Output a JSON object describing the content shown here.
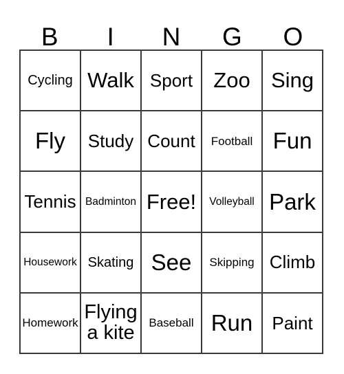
{
  "card": {
    "title": "BINGO",
    "header_letters": [
      "B",
      "I",
      "N",
      "G",
      "O"
    ],
    "free_space_label": "Free!",
    "colors": {
      "border": "#3a3a3a",
      "cell_background": "#ffffff",
      "text": "#000000"
    },
    "rows": [
      [
        {
          "label": "Cycling",
          "size": "sm"
        },
        {
          "label": "Walk",
          "size": "lg"
        },
        {
          "label": "Sport",
          "size": "md"
        },
        {
          "label": "Zoo",
          "size": "lg"
        },
        {
          "label": "Sing",
          "size": "lg"
        }
      ],
      [
        {
          "label": "Fly",
          "size": "xl"
        },
        {
          "label": "Study",
          "size": "md"
        },
        {
          "label": "Count",
          "size": "md"
        },
        {
          "label": "Football",
          "size": "xs"
        },
        {
          "label": "Fun",
          "size": "xl"
        }
      ],
      [
        {
          "label": "Tennis",
          "size": "md"
        },
        {
          "label": "Badminton",
          "size": "xxs"
        },
        {
          "label": "Free!",
          "size": "lg"
        },
        {
          "label": "Volleyball",
          "size": "xxs"
        },
        {
          "label": "Park",
          "size": "xl"
        }
      ],
      [
        {
          "label": "Housework",
          "size": "xxs"
        },
        {
          "label": "Skating",
          "size": "sm"
        },
        {
          "label": "See",
          "size": "xl"
        },
        {
          "label": "Skipping",
          "size": "xs"
        },
        {
          "label": "Climb",
          "size": "md"
        }
      ],
      [
        {
          "label": "Homework",
          "size": "xs"
        },
        {
          "label": "Flying\na kite",
          "size": "two"
        },
        {
          "label": "Baseball",
          "size": "xs"
        },
        {
          "label": "Run",
          "size": "xl"
        },
        {
          "label": "Paint",
          "size": "md"
        }
      ]
    ]
  }
}
